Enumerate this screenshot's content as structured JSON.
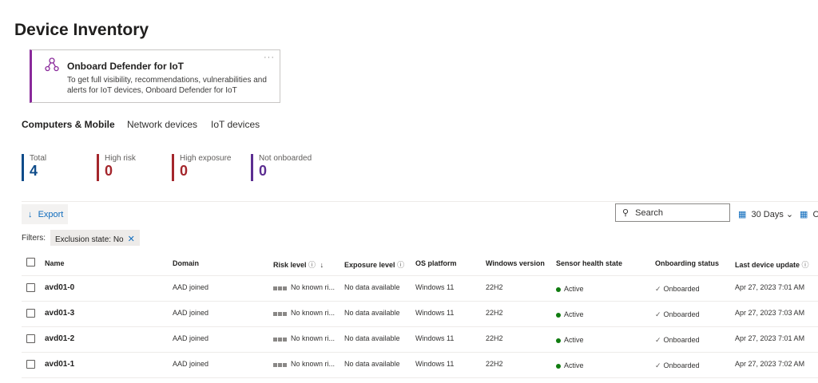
{
  "page": {
    "title": "Device Inventory"
  },
  "promo_card": {
    "title": "Onboard Defender for IoT",
    "description": "To get full visibility, recommendations, vulnerabilities and alerts for IoT devices, Onboard Defender for IoT",
    "more": "···",
    "accent_color": "#8a2a9b"
  },
  "tabs": [
    {
      "label": "Computers & Mobile",
      "active": true
    },
    {
      "label": "Network devices",
      "active": false
    },
    {
      "label": "IoT devices",
      "active": false
    }
  ],
  "stats": [
    {
      "label": "Total",
      "value": "4",
      "color": "#0f4c8a"
    },
    {
      "label": "High risk",
      "value": "0",
      "color": "#a4262c"
    },
    {
      "label": "High exposure",
      "value": "0",
      "color": "#a4262c"
    },
    {
      "label": "Not onboarded",
      "value": "0",
      "color": "#5c2e91"
    }
  ],
  "toolbar": {
    "export_label": "Export",
    "export_icon": "download-icon",
    "search_placeholder": "Search",
    "range_label": "30 Days",
    "columns_label": "C"
  },
  "filters": {
    "label": "Filters:",
    "chip": "Exclusion state: No"
  },
  "table": {
    "headers": {
      "name": "Name",
      "domain": "Domain",
      "risk": "Risk level",
      "exposure": "Exposure level",
      "os": "OS platform",
      "winver": "Windows version",
      "sensor": "Sensor health state",
      "onboarding": "Onboarding status",
      "last_update": "Last device update"
    },
    "rows": [
      {
        "name": "avd01-0",
        "domain": "AAD joined",
        "risk": "No known ri...",
        "exposure": "No data available",
        "os": "Windows 11",
        "winver": "22H2",
        "sensor": "Active",
        "onboarding": "Onboarded",
        "last_update": "Apr 27, 2023 7:01 AM"
      },
      {
        "name": "avd01-3",
        "domain": "AAD joined",
        "risk": "No known ri...",
        "exposure": "No data available",
        "os": "Windows 11",
        "winver": "22H2",
        "sensor": "Active",
        "onboarding": "Onboarded",
        "last_update": "Apr 27, 2023 7:03 AM"
      },
      {
        "name": "avd01-2",
        "domain": "AAD joined",
        "risk": "No known ri...",
        "exposure": "No data available",
        "os": "Windows 11",
        "winver": "22H2",
        "sensor": "Active",
        "onboarding": "Onboarded",
        "last_update": "Apr 27, 2023 7:01 AM"
      },
      {
        "name": "avd01-1",
        "domain": "AAD joined",
        "risk": "No known ri...",
        "exposure": "No data available",
        "os": "Windows 11",
        "winver": "22H2",
        "sensor": "Active",
        "onboarding": "Onboarded",
        "last_update": "Apr 27, 2023 7:02 AM"
      }
    ]
  }
}
